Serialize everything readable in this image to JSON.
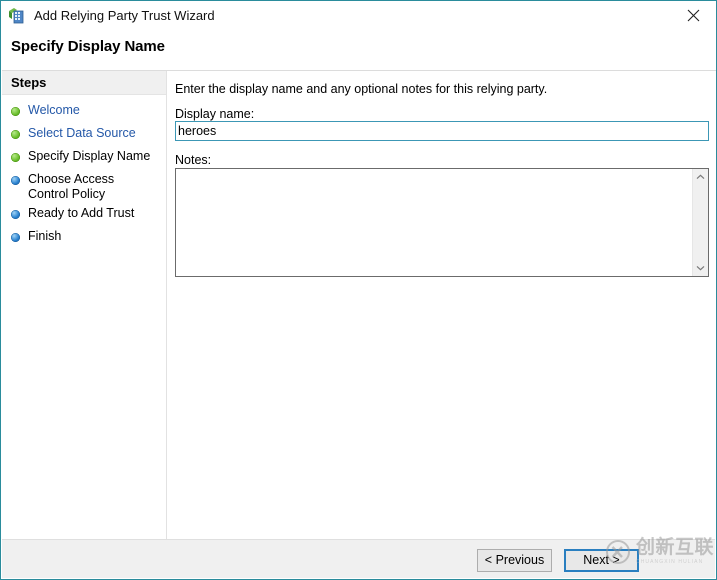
{
  "window": {
    "title": "Add Relying Party Trust Wizard",
    "icon": "wizard-server-icon",
    "close_icon": "close-icon",
    "accent_border": "#2a8c9c"
  },
  "header": {
    "page_title": "Specify Display Name"
  },
  "sidebar": {
    "header_label": "Steps",
    "items": [
      {
        "label": "Welcome",
        "bullet": "green",
        "state": "completed"
      },
      {
        "label": "Select Data Source",
        "bullet": "green",
        "state": "completed"
      },
      {
        "label": "Specify Display Name",
        "bullet": "green",
        "state": "current"
      },
      {
        "label": "Choose Access Control Policy",
        "bullet": "blue",
        "state": "pending"
      },
      {
        "label": "Ready to Add Trust",
        "bullet": "blue",
        "state": "pending"
      },
      {
        "label": "Finish",
        "bullet": "blue",
        "state": "pending"
      }
    ],
    "bullet_colors": {
      "green": "#6cc02e",
      "blue": "#2a82d0"
    },
    "link_color": "#2458a8"
  },
  "main": {
    "intro_text": "Enter the display name and any optional notes for this relying party.",
    "display_name": {
      "label": "Display name:",
      "value": "heroes",
      "placeholder": "",
      "focused": true,
      "border_color": "#3c97b5"
    },
    "notes": {
      "label": "Notes:",
      "value": "",
      "placeholder": "",
      "scrollbar": {
        "up_icon": "chevron-up-icon",
        "down_icon": "chevron-down-icon"
      }
    }
  },
  "footer": {
    "previous_label": "< Previous",
    "next_label": "Next >",
    "default_button": "next",
    "focus_color": "#2a7fc0"
  },
  "watermark": {
    "mark_icon": "circle-x-logo-icon",
    "text": "创新互联",
    "subtext": "CHUANGXIN HULIAN"
  }
}
